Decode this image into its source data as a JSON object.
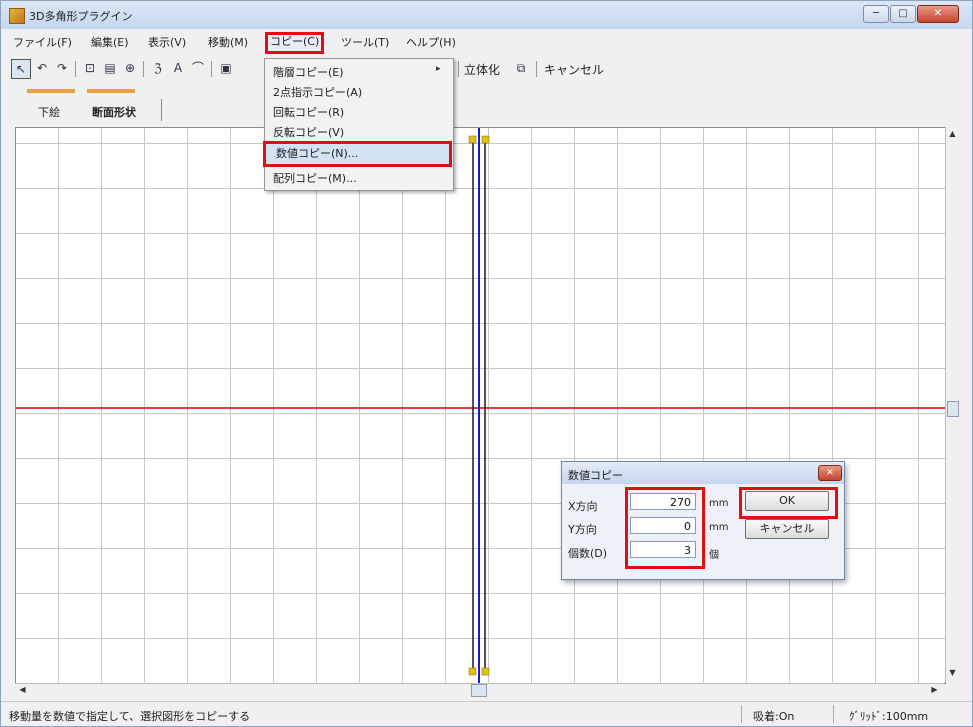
{
  "window": {
    "title": "3D多角形プラグイン",
    "controls": {
      "minimize": "─",
      "maximize": "□",
      "close": "✕"
    }
  },
  "menubar": {
    "items": [
      "ファイル(F)",
      "編集(E)",
      "表示(V)",
      "移動(M)",
      "コピー(C)",
      "ツール(T)",
      "ヘルプ(H)"
    ],
    "active": "コピー(C)"
  },
  "toolbar": {
    "icons": [
      "cursor-arrow-icon",
      "undo-icon",
      "redo-icon",
      "shape-icon",
      "grid-icon",
      "zoom-icon",
      "rotate-icon",
      "text-icon",
      "arc-icon",
      "frame-icon"
    ],
    "glyphs": [
      "↖",
      "↶",
      "↷",
      "⊡",
      "▤",
      "⊕",
      "ℨ",
      "A",
      "⌒",
      "▣"
    ],
    "solidify_label": "立体化",
    "cancel_label": "キャンセル"
  },
  "tabs": {
    "items": [
      "下絵",
      "断面形状"
    ],
    "accent_color": "#e8a33c"
  },
  "copy_menu": {
    "items": [
      {
        "label": "階層コピー(E)",
        "has_submenu": true
      },
      {
        "label": "2点指示コピー(A)",
        "has_submenu": false
      },
      {
        "label": "回転コピー(R)",
        "has_submenu": false
      },
      {
        "label": "反転コピー(V)",
        "has_submenu": false
      },
      {
        "label": "数値コピー(N)...",
        "has_submenu": false,
        "highlighted": true
      },
      {
        "label": "配列コピー(M)...",
        "has_submenu": false
      }
    ],
    "submenu_arrow": "▸"
  },
  "canvas": {
    "grid_color": "#c7c7c7",
    "axis_h_color": "#e23b3b",
    "line_blue_color": "#1a1acc",
    "line_dark_color": "#1a1a1a",
    "handle_color": "#e2c200"
  },
  "dialog": {
    "title": "数値コピー",
    "close": "✕",
    "fields": [
      {
        "label": "X方向",
        "value": "270",
        "unit": "mm"
      },
      {
        "label": "Y方向",
        "value": "0",
        "unit": "mm"
      },
      {
        "label": "個数(D)",
        "value": "3",
        "unit": "個"
      }
    ],
    "ok_label": "OK",
    "cancel_label": "キャンセル"
  },
  "statusbar": {
    "message": "移動量を数値で指定して、選択図形をコピーする",
    "snap": "吸着:On",
    "grid": "ｸﾞﾘｯﾄﾞ:100mm"
  },
  "highlight_color": "#e01010"
}
